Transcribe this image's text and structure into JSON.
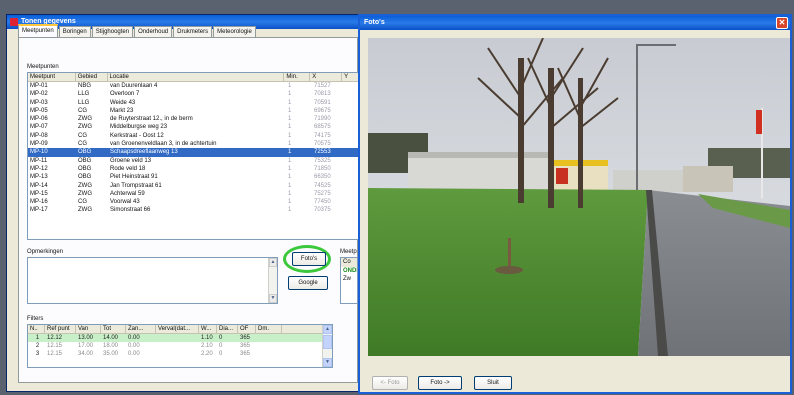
{
  "main_window": {
    "title": "Tonen gegevens",
    "tabs": [
      "Meetpunten",
      "Boringen",
      "Stijghoogten",
      "Onderhoud",
      "Drukmeters",
      "Meteorologie"
    ],
    "meetpunten_label": "Meetpunten",
    "columns": [
      "Meetpunt",
      "Gebied",
      "Locatie",
      "Min.",
      "X",
      "Y"
    ],
    "rows": [
      {
        "meetpunt": "MP-01",
        "gebied": "NBG",
        "locatie": "van Duurenlaan 4",
        "min": "1",
        "x": "71527"
      },
      {
        "meetpunt": "MP-02",
        "gebied": "LLG",
        "locatie": "Overloon 7",
        "min": "1",
        "x": "70813"
      },
      {
        "meetpunt": "MP-03",
        "gebied": "LLG",
        "locatie": "Weide 43",
        "min": "1",
        "x": "70591"
      },
      {
        "meetpunt": "MP-05",
        "gebied": "CG",
        "locatie": "Markt 23",
        "min": "1",
        "x": "69675"
      },
      {
        "meetpunt": "MP-06",
        "gebied": "ZWG",
        "locatie": "de Ruyterstraat 12., in de berm",
        "min": "1",
        "x": "71990"
      },
      {
        "meetpunt": "MP-07",
        "gebied": "ZWG",
        "locatie": "Middelburgse weg 23",
        "min": "1",
        "x": "68575"
      },
      {
        "meetpunt": "MP-08",
        "gebied": "CG",
        "locatie": "Kerkstraat - Oost 12",
        "min": "1",
        "x": "74175"
      },
      {
        "meetpunt": "MP-09",
        "gebied": "CG",
        "locatie": "van Groenenveldlaan 3, in de achtertuin",
        "min": "1",
        "x": "70575"
      },
      {
        "meetpunt": "MP-10",
        "gebied": "OBG",
        "locatie": "Schaapsdreeflaanweg 13",
        "min": "1",
        "x": "72553",
        "selected": true
      },
      {
        "meetpunt": "MP-11",
        "gebied": "OBG",
        "locatie": "Groene veld 13",
        "min": "1",
        "x": "75325"
      },
      {
        "meetpunt": "MP-12",
        "gebied": "OBG",
        "locatie": "Rode veld 18",
        "min": "1",
        "x": "71850"
      },
      {
        "meetpunt": "MP-13",
        "gebied": "OBG",
        "locatie": "Piet Heinstraat 91",
        "min": "1",
        "x": "66350"
      },
      {
        "meetpunt": "MP-14",
        "gebied": "ZWG",
        "locatie": "Jan Trompstraat 61",
        "min": "1",
        "x": "74525"
      },
      {
        "meetpunt": "MP-15",
        "gebied": "ZWG",
        "locatie": "Achterwal 59",
        "min": "1",
        "x": "75275"
      },
      {
        "meetpunt": "MP-16",
        "gebied": "CG",
        "locatie": "Voorwal 43",
        "min": "1",
        "x": "77450"
      },
      {
        "meetpunt": "MP-17",
        "gebied": "ZWG",
        "locatie": "Simonstraat 66",
        "min": "1",
        "x": "70375"
      }
    ],
    "opmerkingen_label": "Opmerkingen",
    "fotos_button": "Foto's",
    "google_button": "Google",
    "meetpunt_side": {
      "label": "Meetp",
      "col": "Co",
      "val1": "ONDE",
      "val2": "Zw"
    },
    "filters_label": "Filters",
    "filter_columns": [
      "N..",
      "Ref punt",
      "Van",
      "Tot",
      "Zan...",
      "Verval(dat...",
      "W...",
      "Dia...",
      "OF",
      "Dm."
    ],
    "filter_rows": [
      {
        "n": "1",
        "ref": "12.12",
        "van": "13.00",
        "tot": "14.00",
        "zan": "0.00",
        "verval": "",
        "w": "1.10",
        "dia": "0",
        "of": "365",
        "selected": true
      },
      {
        "n": "2",
        "ref": "12.15",
        "van": "17.00",
        "tot": "18.00",
        "zan": "0.00",
        "verval": "",
        "w": "2.10",
        "dia": "0",
        "of": "365"
      },
      {
        "n": "3",
        "ref": "12.15",
        "van": "34.00",
        "tot": "35.00",
        "zan": "0.00",
        "verval": "",
        "w": "2.20",
        "dia": "0",
        "of": "365"
      }
    ]
  },
  "photo_window": {
    "title": "Foto's",
    "prev_button": "<- Foto",
    "next_button": "Foto ->",
    "close_button": "Sluit"
  },
  "colors": {
    "title_bar": "#0a5fd8",
    "selection": "#316ac5",
    "highlight_ring": "#3cc83c"
  }
}
